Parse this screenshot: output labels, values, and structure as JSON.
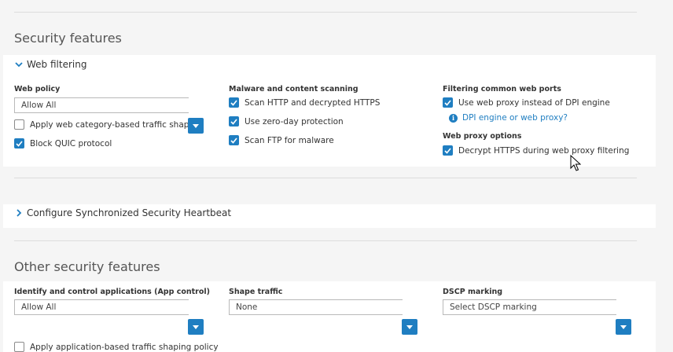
{
  "security": {
    "heading": "Security features",
    "web_filtering": {
      "title": "Web filtering",
      "web_policy": {
        "label": "Web policy",
        "value": "Allow All",
        "shaping_label": "Apply web category-based traffic shaping",
        "shaping_checked": false,
        "quic_label": "Block QUIC protocol",
        "quic_checked": true
      },
      "malware": {
        "label": "Malware and content scanning",
        "items": [
          {
            "label": "Scan HTTP and decrypted HTTPS",
            "checked": true
          },
          {
            "label": "Use zero-day protection",
            "checked": true
          },
          {
            "label": "Scan FTP for malware",
            "checked": true
          }
        ]
      },
      "ports": {
        "label": "Filtering common web ports",
        "proxy_label": "Use web proxy instead of DPI engine",
        "proxy_checked": true,
        "link": "DPI engine or web proxy?"
      },
      "proxy_options": {
        "label": "Web proxy options",
        "decrypt_label": "Decrypt HTTPS during web proxy filtering",
        "decrypt_checked": true
      }
    },
    "heartbeat": {
      "title": "Configure Synchronized Security Heartbeat"
    }
  },
  "other": {
    "heading": "Other security features",
    "app_control": {
      "label": "Identify and control applications (App control)",
      "value": "Allow All",
      "shaping_label": "Apply application-based traffic shaping policy"
    },
    "shape_traffic": {
      "label": "Shape traffic",
      "value": "None"
    },
    "dscp": {
      "label": "DSCP marking",
      "value": "Select DSCP marking"
    }
  },
  "colors": {
    "accent": "#1f7ec1",
    "background": "#f5f5f5",
    "panel": "#ffffff"
  },
  "icons": [
    "chevron-down-icon",
    "chevron-right-icon",
    "checkmark-icon",
    "info-icon",
    "caret-down-icon",
    "mouse-cursor-icon"
  ]
}
